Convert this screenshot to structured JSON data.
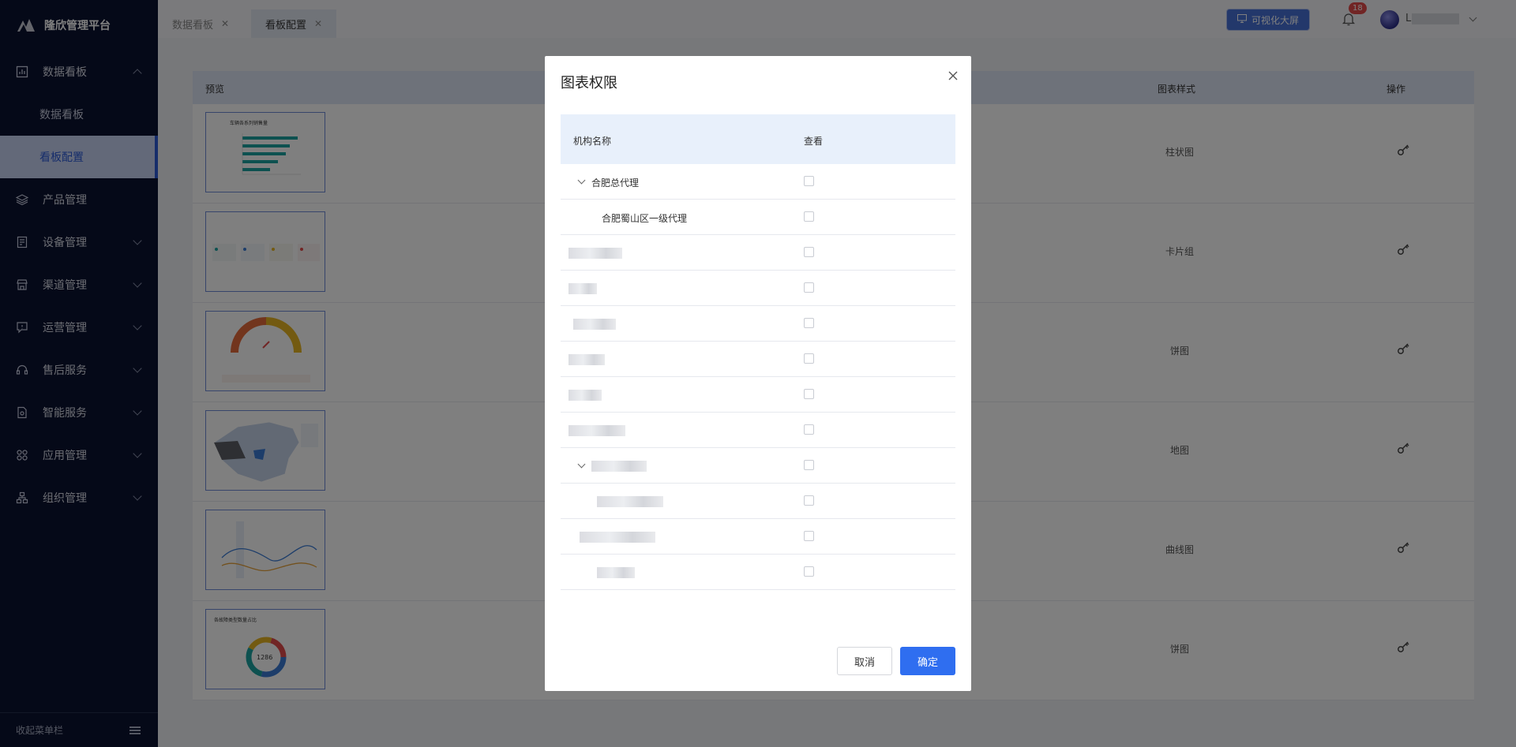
{
  "app": {
    "title": "隆欣管理平台"
  },
  "sidebar": {
    "items": [
      {
        "label": "数据看板",
        "icon": "dashboard-icon",
        "expanded": true
      },
      {
        "label": "数据看板",
        "sub": true
      },
      {
        "label": "看板配置",
        "sub": true,
        "active": true
      },
      {
        "label": "产品管理",
        "icon": "layers-icon"
      },
      {
        "label": "设备管理",
        "icon": "device-icon"
      },
      {
        "label": "渠道管理",
        "icon": "store-icon"
      },
      {
        "label": "运营管理",
        "icon": "chat-icon"
      },
      {
        "label": "售后服务",
        "icon": "headset-icon"
      },
      {
        "label": "智能服务",
        "icon": "document-icon"
      },
      {
        "label": "应用管理",
        "icon": "apps-icon"
      },
      {
        "label": "组织管理",
        "icon": "org-icon"
      }
    ],
    "collapse_label": "收起菜单栏"
  },
  "tabs": [
    {
      "label": "数据看板",
      "active": false
    },
    {
      "label": "看板配置",
      "active": true
    }
  ],
  "header": {
    "viz_button": "可视化大屏",
    "notification_count": "18",
    "user_initial": "L"
  },
  "table": {
    "columns": {
      "preview": "预览",
      "style": "图表样式",
      "action": "操作"
    },
    "rows": [
      {
        "style": "柱状图"
      },
      {
        "style": "卡片组"
      },
      {
        "style": "饼图"
      },
      {
        "style": "地图"
      },
      {
        "style": "曲线图"
      },
      {
        "style": "饼图"
      }
    ]
  },
  "thumbs": {
    "bar_title": "车辆各系列销售量",
    "donut_title": "各故障类型数量占比",
    "donut_value": "1286"
  },
  "modal": {
    "title": "图表权限",
    "columns": {
      "org": "机构名称",
      "view": "查看"
    },
    "rows": [
      {
        "name": "合肥总代理",
        "level": 0,
        "expandable": true
      },
      {
        "name": "合肥蜀山区一级代理",
        "level": 1
      },
      {
        "name": "",
        "level": 0,
        "blurred": true
      },
      {
        "name": "",
        "level": 0,
        "blurred": true
      },
      {
        "name": "",
        "level": 0,
        "blurred": true
      },
      {
        "name": "",
        "level": 0,
        "blurred": true
      },
      {
        "name": "",
        "level": 0,
        "blurred": true
      },
      {
        "name": "",
        "level": 0,
        "blurred": true
      },
      {
        "name": "",
        "level": 0,
        "blurred": true,
        "expandable": true
      },
      {
        "name": "",
        "level": 1,
        "blurred": true
      },
      {
        "name": "",
        "level": 0,
        "blurred": true
      },
      {
        "name": "",
        "level": 1,
        "blurred": true
      }
    ],
    "cancel_label": "取消",
    "ok_label": "确定"
  }
}
